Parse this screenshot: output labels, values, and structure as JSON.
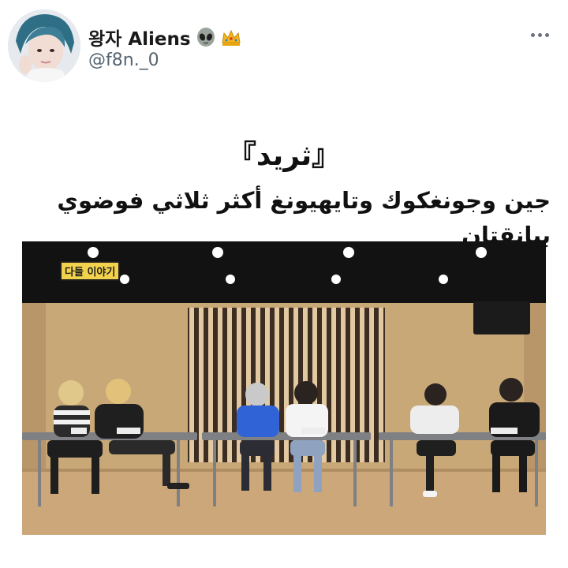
{
  "author": {
    "display_name": "왕자 Aliens",
    "handle": "@f8n._0",
    "avatar_icon": "profile-photo",
    "badges": [
      "alien-icon",
      "crown-icon"
    ]
  },
  "more_icon": "more-dots-icon",
  "tweet": {
    "line1": "『ثريد』",
    "line2": "جين وجونغكوك وتايهيونغ أكثر ثلاثي فوضوي ببانقتان"
  },
  "media": {
    "caption": "다들 이야기",
    "colors": {
      "wall": "#c9a878",
      "floor": "#cba77a",
      "ceiling": "#121212"
    }
  }
}
